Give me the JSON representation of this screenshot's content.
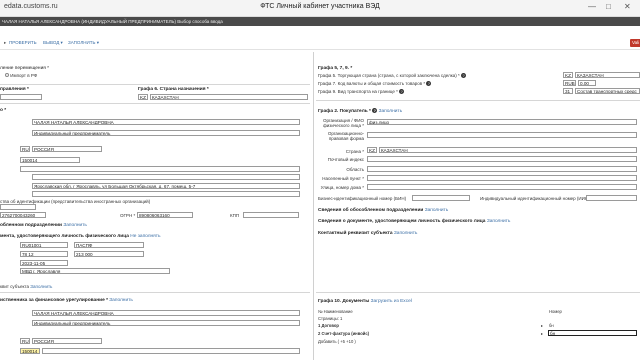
{
  "window": {
    "url": "edata.customs.ru",
    "title": "ФТС Личный кабинет участника ВЭД",
    "controls": [
      "—",
      "□",
      "✕"
    ]
  },
  "header": {
    "text": "ЧАЛАЯ НАТАЛЬЯ АЛЕКСАНДРОВНА (ИНДИВИДУАЛЬНЫЙ ПРЕДПРИНИМАТЕЛЬ)   Выбор способа ввода"
  },
  "toolbar": {
    "buttons": [
      "ПРОВЕРИТЬ",
      "ВЫВОД ▾",
      "ЗАПОЛНИТЬ ▾"
    ],
    "red_label": "Vali"
  },
  "left": {
    "movement_label": "ление перемещения *",
    "radio_label": "Импорт в РФ",
    "dispatch_label": "правления *",
    "graph6_label": "Графа 6. Страна назначения *",
    "graph6_code": "KZ",
    "graph6_country": "КАЗАХСТАН",
    "graph1_label": "о *",
    "full_name": "ЧАЛАЯ НАТАЛЬЯ АЛЕКСАНДРОВНА",
    "status": "Индивидуальный предприниматель",
    "country_code": "RU",
    "country_name": "РОССИЯ",
    "postcode": "150014",
    "address": "Ярославская обл, г Ярославль, ул Большая Октябрьская, д. 67, помещ. 5-7",
    "identification_note": "ства об идентификации (представительства иностранных организаций)",
    "inn": "2762700043260",
    "ogrn_label": "ОГРН *",
    "ogrn": "890806063160",
    "kpp_label": "КПП",
    "separate_div": "обленном подразделении",
    "separate_div_link": "Заполнить",
    "id_doc_label": "мента, удостоверяющего личность физического лица",
    "id_doc_link": "Не заполнять",
    "doc_code": "RU01001",
    "doc_name": "ПАСПФ",
    "series": "78 12",
    "number": "213 000",
    "issued_date": "2023-11-05",
    "issued_by": "МВД г. Ярославля",
    "contact_label": "квит субъекта",
    "contact_link": "Заполнить",
    "fin_label": "иственника за финансовое урегулирование *",
    "fin_link": "Заполнить",
    "fin_name": "ЧАЛАЯ НАТАЛЬЯ АЛЕКСАНДРОВНА",
    "fin_status": "Индивидуальный предприниматель",
    "fin_country_code": "RU",
    "fin_country_name": "РОССИЯ",
    "fin_postcode": "150014"
  },
  "right": {
    "graph5_9_label": "Графа 5, 7, 9. *",
    "trading_country_label": "Графа 5. Торгующая страна (страна, с которой заключена сделка) *",
    "trading_country_code": "KZ",
    "trading_country_name": "КАЗАХСТАН",
    "currency_label": "Графа 7. Код валюты и общая стоимость товаров *",
    "currency_code": "RUB",
    "currency_value": "0,00",
    "transport_label": "Графа 9. Вид транспорта на границе *",
    "transport_code": "31",
    "transport_name": "Состав транспортных средс",
    "buyer_label": "Графа 2. Покупатель *",
    "buyer_link": "Заполнить",
    "org_label": "Организация / ФИО физического лица *",
    "org_value": "физ.лицо",
    "legal_form_label": "Организационно-правовая форма",
    "country_label": "Страна *",
    "country_code": "KZ",
    "country_name": "КАЗАХСТАН",
    "postal_label": "Почтовый индекс",
    "region_label": "Область",
    "locality_label": "Населенный пункт *",
    "street_label": "Улица, номер дома *",
    "bin_label": "Бизнес-идентификационный номер (БИН)",
    "iin_label": "Индивидуальный идентификационный номер (ИИН)",
    "separate_div_label": "Сведения об обособленном подразделении",
    "separate_div_link": "Заполнить",
    "id_doc_label": "Сведения о документе, удостоверяющем личность физического лица",
    "id_doc_link": "Заполнить",
    "contact_label": "Контактный реквизит субъекта",
    "contact_link": "Заполнить",
    "docs_label": "Графа 10. Документы",
    "docs_link": "Загрузить из Excel",
    "docs_col1": "№ Наименование",
    "docs_col2": "Номер",
    "docs_pages": "Страницы: 1",
    "docs_rows": [
      {
        "n": "1",
        "name": "Договор",
        "num": "бн"
      },
      {
        "n": "2",
        "name": "Счет-фактура (инвойс)",
        "num": "бн"
      }
    ],
    "docs_add": "Добавить  ( +5  +10 )"
  }
}
